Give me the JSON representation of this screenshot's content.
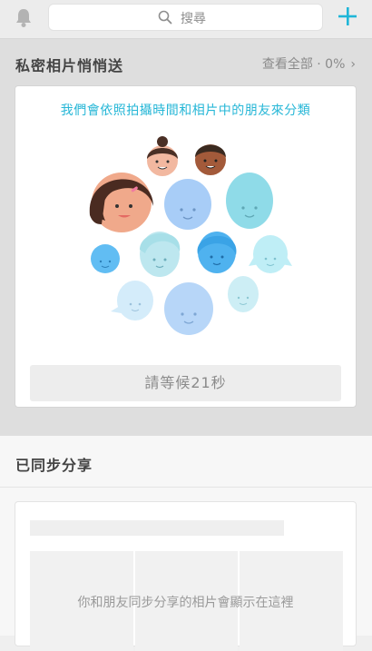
{
  "header": {
    "search_placeholder": "搜尋",
    "bell_icon": "bell-icon",
    "add_icon": "plus-icon",
    "accent": "#1fb6d8"
  },
  "private_albums": {
    "title": "私密相片悄悄送",
    "see_all": "查看全部 · 0%",
    "card_message": "我們會依照拍攝時間和相片中的朋友來分類",
    "wait_button": "請等候21秒"
  },
  "synced": {
    "title": "已同步分享",
    "empty_message": "你和朋友同步分享的相片會顯示在這裡"
  }
}
